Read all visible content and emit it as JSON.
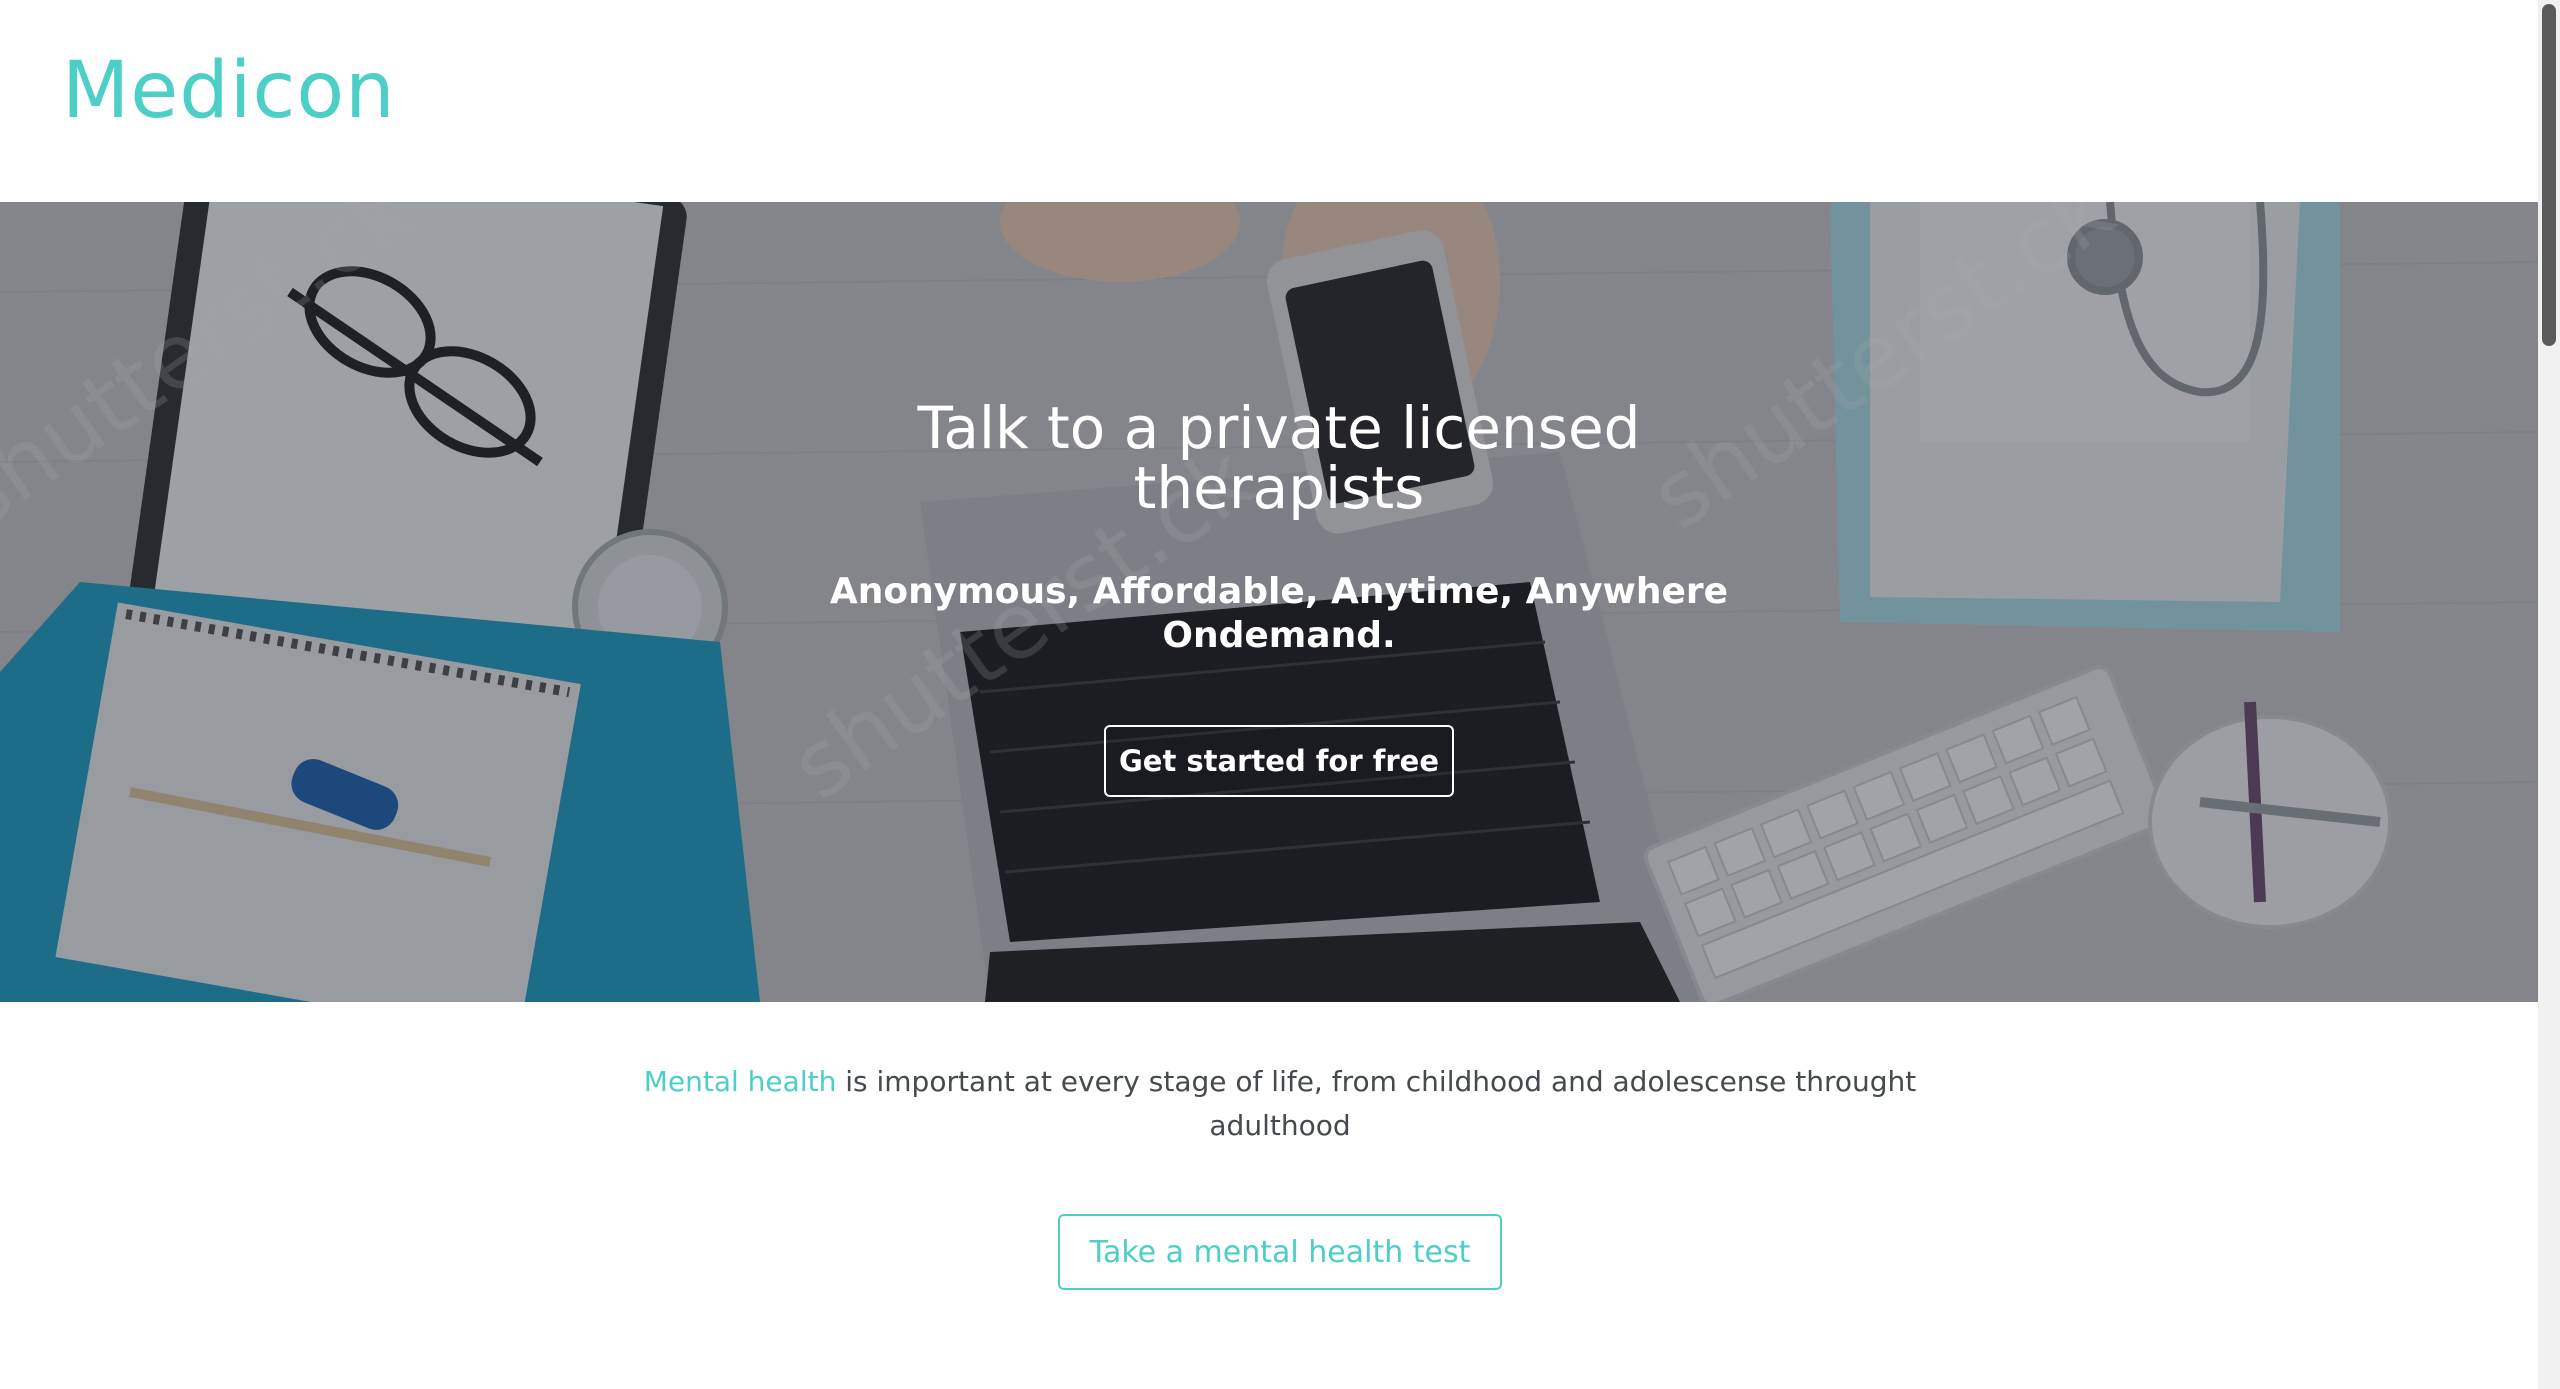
{
  "brand": {
    "logo_text": "Medicon",
    "accent_color": "#4ccfc6"
  },
  "hero": {
    "title": "Talk to a private licensed therapists",
    "subtitle": "Anonymous, Affordable, Anytime, Anywhere Ondemand.",
    "cta_label": "Get started for free",
    "watermark_text": "shutterst.ck"
  },
  "info": {
    "highlight": "Mental health",
    "text": " is important at every stage of life, from childhood and adolescense throught adulthood",
    "button_label": "Take a mental health test"
  }
}
